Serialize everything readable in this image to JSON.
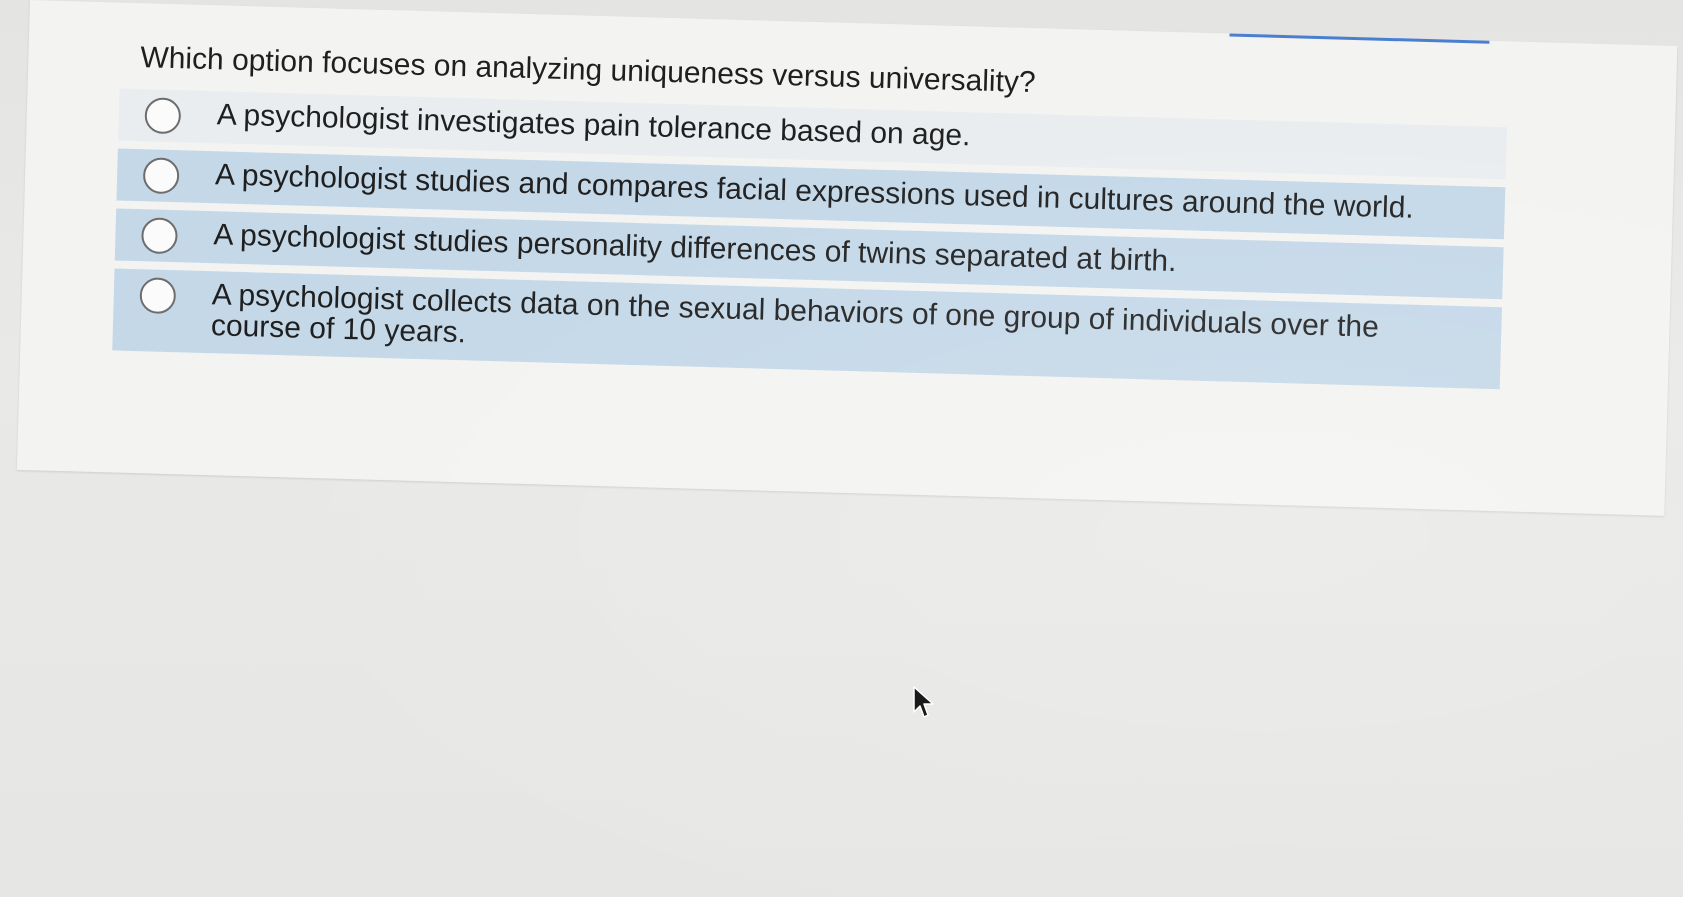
{
  "question": {
    "text": "Which option focuses on analyzing uniqueness versus universality?"
  },
  "options": [
    {
      "label": "A psychologist investigates pain tolerance based on age."
    },
    {
      "label": "A psychologist studies and compares facial expressions used in cultures around the world."
    },
    {
      "label": "A psychologist studies personality differences of twins separated at birth."
    },
    {
      "label": "A psychologist collects data on the sexual behaviors of one group of individuals over the course of 10 years."
    }
  ],
  "colors": {
    "option_shade": "#c4d8e8",
    "accent": "#4a7fd0",
    "text": "#1f1f1f"
  },
  "icons": {
    "radio": "radio-unselected-icon",
    "cursor": "mouse-pointer-icon"
  }
}
